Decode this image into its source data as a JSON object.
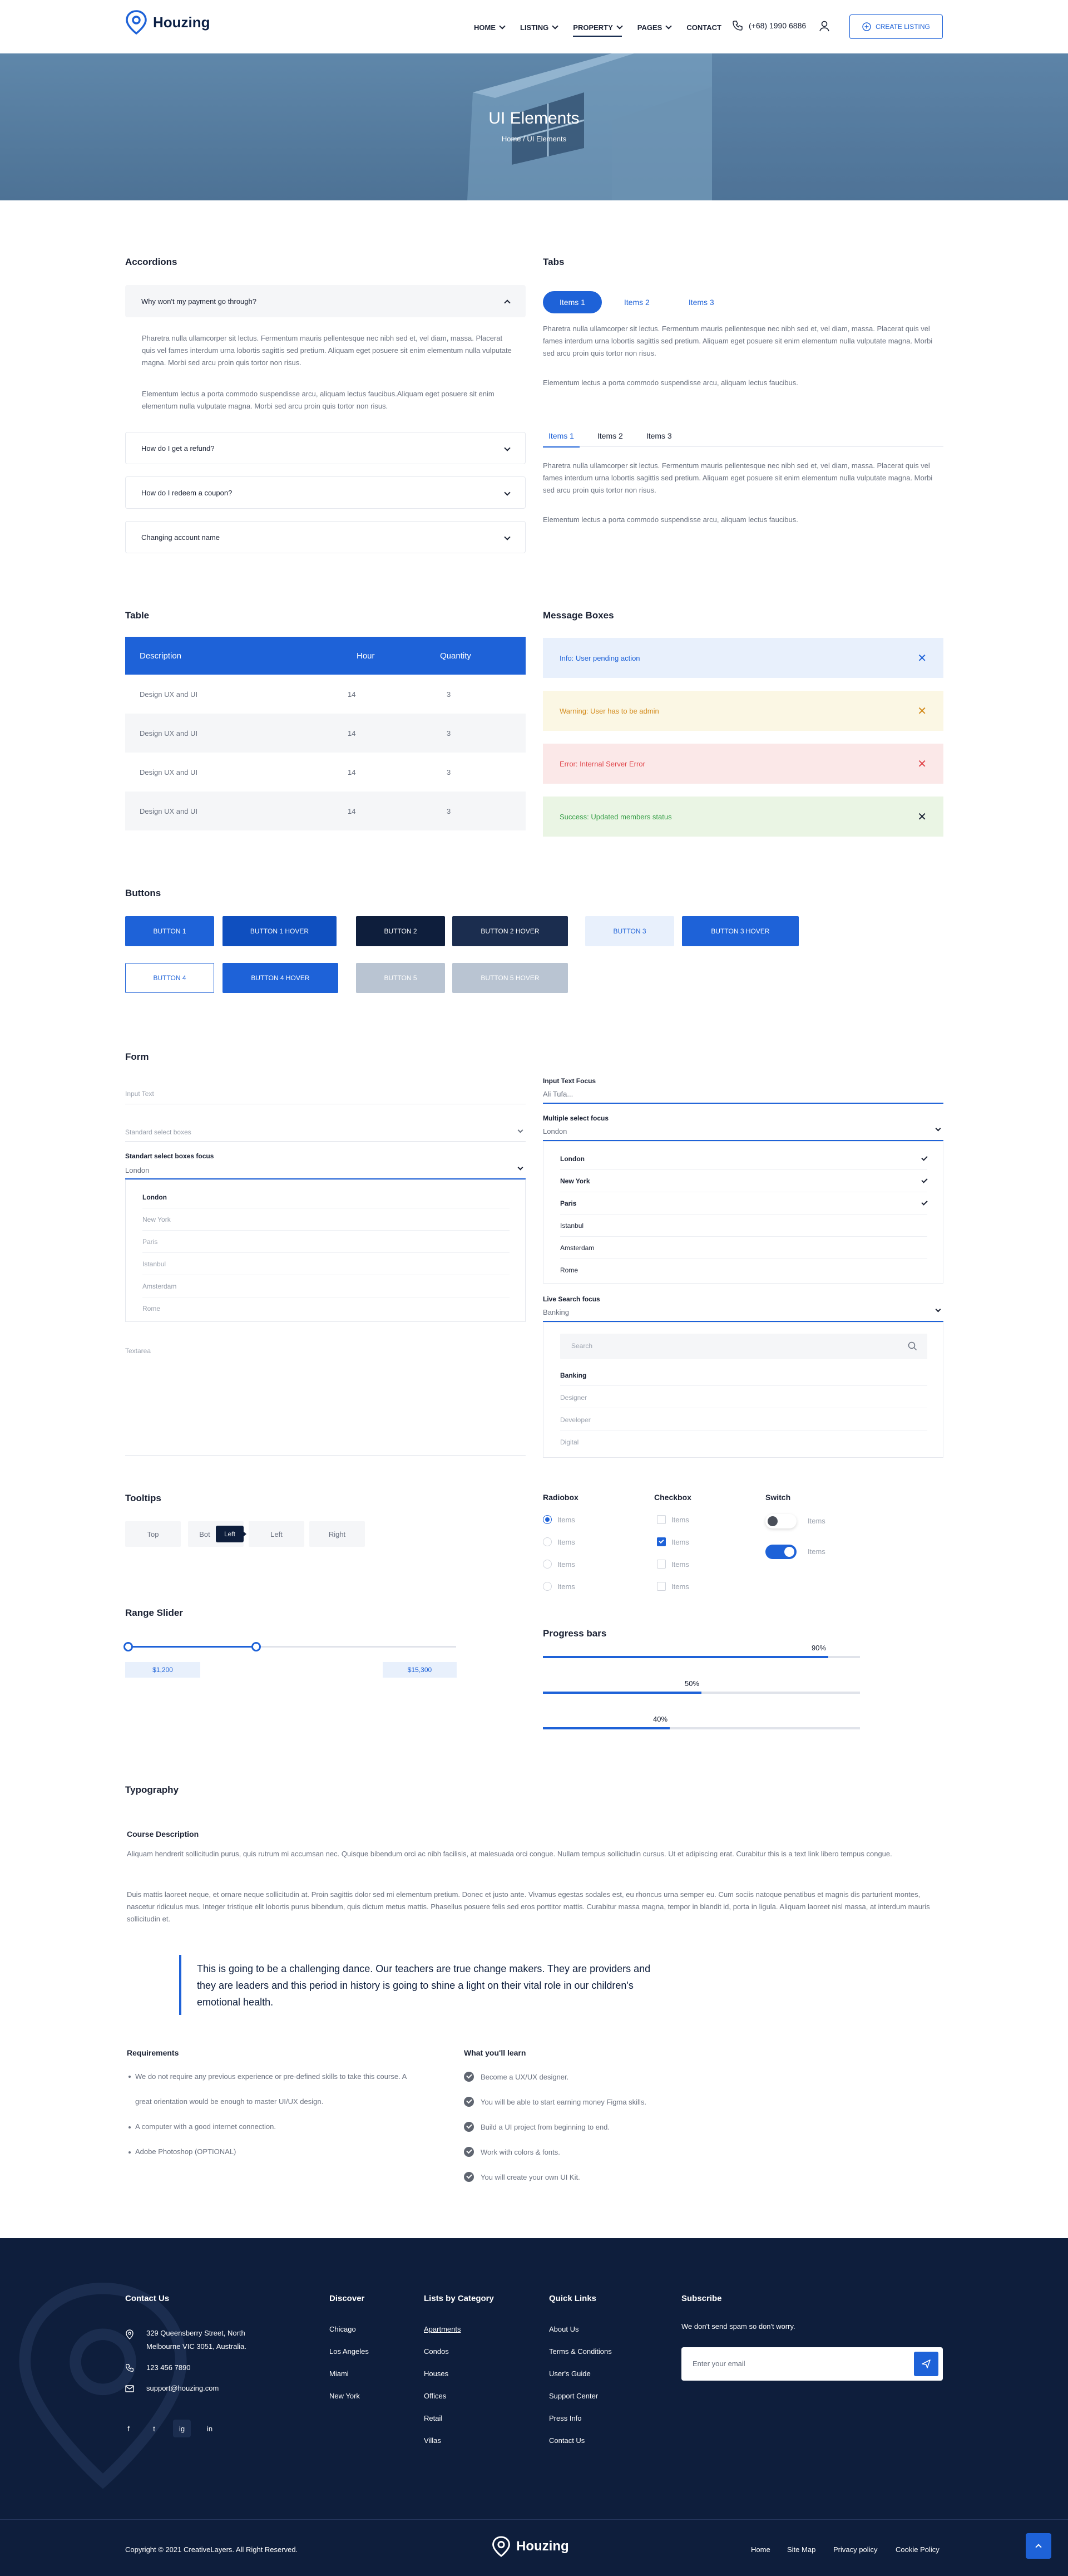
{
  "header": {
    "logo": "Houzing",
    "nav": [
      {
        "label": "HOME",
        "dropdown": true
      },
      {
        "label": "LISTING",
        "dropdown": true
      },
      {
        "label": "PROPERTY",
        "dropdown": true,
        "active": true
      },
      {
        "label": "PAGES",
        "dropdown": true
      },
      {
        "label": "CONTACT",
        "dropdown": false
      }
    ],
    "phone": "(+68) 1990 6886",
    "create_listing": "CREATE LISTING"
  },
  "hero": {
    "title": "UI Elements",
    "breadcrumb": "Home / UI Elements"
  },
  "accordions": {
    "title": "Accordions",
    "items": [
      {
        "q": "Why won't my payment go through?",
        "open": true
      },
      {
        "q": "How do I get a refund?"
      },
      {
        "q": "How do I redeem a coupon?"
      },
      {
        "q": "Changing account name"
      }
    ],
    "p1": "Pharetra nulla ullamcorper sit lectus. Fermentum mauris pellentesque nec nibh sed et, vel diam, massa. Placerat quis vel fames interdum urna lobortis sagittis sed pretium. Aliquam eget posuere sit enim elementum nulla vulputate magna. Morbi sed arcu proin quis tortor non risus.",
    "p2": "Elementum lectus a porta commodo suspendisse arcu, aliquam lectus faucibus.Aliquam eget posuere sit enim elementum nulla vulputate magna. Morbi sed arcu proin quis tortor non risus."
  },
  "tabs": {
    "title": "Tabs",
    "labels": [
      "Items 1",
      "Items 2",
      "Items 3"
    ],
    "p1": "Pharetra nulla ullamcorper sit lectus. Fermentum mauris pellentesque nec nibh sed et, vel diam, massa. Placerat quis vel fames interdum urna lobortis sagittis sed pretium. Aliquam eget posuere sit enim elementum nulla vulputate magna. Morbi sed arcu proin quis tortor non risus.",
    "p2": "Elementum lectus a porta commodo suspendisse arcu, aliquam lectus faucibus."
  },
  "table": {
    "title": "Table",
    "headers": [
      "Description",
      "Hour",
      "Quantity"
    ],
    "rows": [
      [
        "Design UX and UI",
        "14",
        "3"
      ],
      [
        "Design UX and UI",
        "14",
        "3"
      ],
      [
        "Design UX and UI",
        "14",
        "3"
      ],
      [
        "Design UX and UI",
        "14",
        "3"
      ]
    ]
  },
  "messages": {
    "title": "Message Boxes",
    "items": [
      {
        "text": "Info: User pending action",
        "color": "#1e62d8"
      },
      {
        "text": "Warning: User has to be admin",
        "color": "#d38a1b"
      },
      {
        "text": "Error: Internal Server Error",
        "color": "#e0474c"
      },
      {
        "text": "Success: Updated members status",
        "color": "#3aa04a"
      }
    ]
  },
  "buttons": {
    "title": "Buttons",
    "b1": "BUTTON 1",
    "b1h": "BUTTON 1 HOVER",
    "b2": "BUTTON 2",
    "b2h": "BUTTON 2 HOVER",
    "b3": "BUTTON 3",
    "b3h": "BUTTON 3 HOVER",
    "b4": "BUTTON 4",
    "b4h": "BUTTON 4 HOVER",
    "b5": "BUTTON 5",
    "b5h": "BUTTON 5 HOVER"
  },
  "form": {
    "title": "Form",
    "input_text": "Input Text",
    "input_focus_label": "Input Text Focus",
    "input_focus_value": "Ali Tufa...",
    "standard_select": "Standard select boxes",
    "multi_label": "Multiple select focus",
    "multi_value": "London",
    "multi_options": [
      "London",
      "New York",
      "Paris",
      "Istanbul",
      "Amsterdam",
      "Rome"
    ],
    "standard_focus_label": "Standart select boxes focus",
    "standard_focus_value": "London",
    "standard_options": [
      "London",
      "New York",
      "Paris",
      "Istanbul",
      "Amsterdam",
      "Rome"
    ],
    "live_label": "Live Search focus",
    "live_value": "Banking",
    "live_search_placeholder": "Search",
    "live_options": [
      "Banking",
      "Designer",
      "Developer",
      "Digital"
    ],
    "textarea": "Textarea"
  },
  "tooltips": {
    "title": "Tooltips",
    "buttons": [
      "Top",
      "Bot",
      "Left",
      "Right"
    ],
    "tip": "Left"
  },
  "radiobox": {
    "title": "Radiobox",
    "items": [
      "Items",
      "Items",
      "Items",
      "Items"
    ]
  },
  "checkbox": {
    "title": "Checkbox",
    "items": [
      "Items",
      "Items",
      "Items",
      "Items"
    ]
  },
  "switch": {
    "title": "Switch",
    "items": [
      "Items",
      "Items"
    ]
  },
  "range": {
    "title": "Range Slider",
    "min": "$1,200",
    "max": "$15,300",
    "low_fraction": 0.0,
    "high_fraction": 0.39
  },
  "progress": {
    "title": "Progress bars",
    "bars": [
      {
        "label": "90%",
        "value": 90
      },
      {
        "label": "50%",
        "value": 50
      },
      {
        "label": "40%",
        "value": 40
      }
    ]
  },
  "typography": {
    "title": "Typography",
    "subtitle": "Course Description",
    "p1": "Aliquam hendrerit sollicitudin purus, quis rutrum mi accumsan nec. Quisque bibendum orci ac nibh facilisis, at malesuada orci congue. Nullam tempus sollicitudin cursus. Ut et adipiscing erat. Curabitur this is a text link libero tempus congue.",
    "p2": "Duis mattis laoreet neque, et ornare neque sollicitudin at. Proin sagittis dolor sed mi elementum pretium. Donec et justo ante. Vivamus egestas sodales est, eu rhoncus urna semper eu. Cum sociis natoque penatibus et magnis dis parturient montes, nascetur ridiculus mus. Integer tristique elit lobortis purus bibendum, quis dictum metus mattis. Phasellus posuere felis sed eros porttitor mattis. Curabitur massa magna, tempor in blandit id, porta in ligula. Aliquam laoreet nisl massa, at interdum mauris sollicitudin et.",
    "quote": "This is going to be a challenging dance. Our teachers are true change makers. They are providers and they are leaders and this period in history is going to shine a light on their vital role in our children's emotional health.",
    "req_title": "Requirements",
    "requirements": [
      "We do not require any previous experience or pre-defined skills to take this course. A",
      "great orientation would be enough to master UI/UX design.",
      "A computer with a good internet connection.",
      "Adobe Photoshop (OPTIONAL)"
    ],
    "learn_title": "What you'll learn",
    "learn": [
      "Become a UX/UX designer.",
      "You will be able to start earning money Figma skills.",
      "Build a UI project from beginning to end.",
      "Work with colors & fonts.",
      "You will create your own UI Kit."
    ]
  },
  "footer": {
    "contact_title": "Contact Us",
    "address1": "329 Queensberry Street, North",
    "address2": "Melbourne VIC 3051, Australia.",
    "phone": "123 456 7890",
    "email": "support@houzing.com",
    "discover_title": "Discover",
    "discover": [
      "Chicago",
      "Los Angeles",
      "Miami",
      "New York"
    ],
    "category_title": "Lists by Category",
    "categories": [
      "Apartments",
      "Condos",
      "Houses",
      "Offices",
      "Retail",
      "Villas"
    ],
    "quick_title": "Quick Links",
    "quick": [
      "About Us",
      "Terms & Conditions",
      "User's Guide",
      "Support Center",
      "Press Info",
      "Contact Us"
    ],
    "subscribe_title": "Subscribe",
    "subscribe_text": "We don't send spam so don't worry.",
    "email_placeholder": "Enter your email",
    "social": [
      "f",
      "t",
      "ig",
      "in"
    ],
    "copyright": "Copyright © 2021 CreativeLayers. All Right Reserved.",
    "logo": "Houzing",
    "bottom_links": [
      "Home",
      "Site Map",
      "Privacy policy",
      "Cookie Policy"
    ]
  }
}
